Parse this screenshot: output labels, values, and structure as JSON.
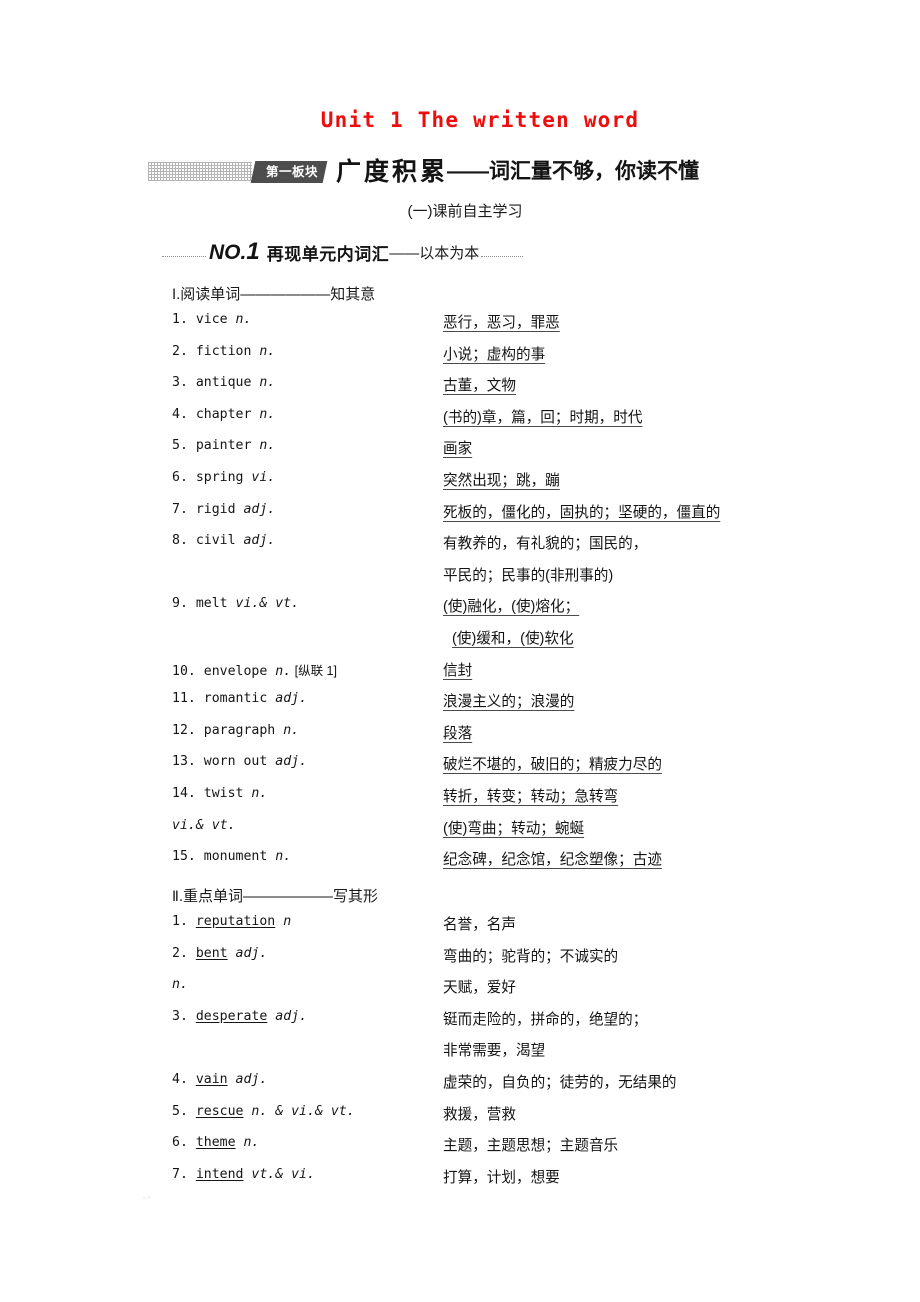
{
  "unit": {
    "title": "Unit 1 The written word",
    "title_color": "#ee0d0d"
  },
  "banner": {
    "tag": "第一板块",
    "main": "广度积累",
    "sub": "——词汇量不够，你读不懂",
    "tag_bg": "#4d4d4d"
  },
  "sub_heading": "(一)课前自主学习",
  "no_heading": {
    "label_prefix": "NO.",
    "label_digit": "1",
    "main": "再现单元内词汇",
    "tail": "——以本为本"
  },
  "sections": [
    {
      "heading_num": "Ⅰ",
      "heading_text": ".阅读单词——————知其意",
      "definitions_underlined": true,
      "rows": [
        {
          "num": "1.",
          "word": "vice",
          "pos": "n.",
          "def": "恶行，恶习，罪恶",
          "underline": true
        },
        {
          "num": "2.",
          "word": "fiction",
          "pos": "n.",
          "def": "小说；虚构的事",
          "underline": true
        },
        {
          "num": "3.",
          "word": "antique",
          "pos": "n.",
          "def": "古董，文物",
          "underline": true
        },
        {
          "num": "4.",
          "word": "chapter",
          "pos": "n.",
          "def": "(书的)章，篇，回；时期，时代",
          "underline": true
        },
        {
          "num": "5.",
          "word": "painter",
          "pos": "n.",
          "def": "画家",
          "underline": true
        },
        {
          "num": "6.",
          "word": "spring",
          "pos": "vi.",
          "def": "突然出现；跳，蹦",
          "underline": true
        },
        {
          "num": "7.",
          "word": "rigid",
          "pos": "adj.",
          "def": "死板的，僵化的，固执的；坚硬的，僵直的",
          "underline": true
        },
        {
          "num": "8.",
          "word": "civil",
          "pos": "adj.",
          "def": "有教养的，有礼貌的；国民的，",
          "underline": false
        },
        {
          "num": "",
          "word": "",
          "pos": "",
          "def": "平民的；民事的(非刑事的)",
          "underline": false
        },
        {
          "num": "9.",
          "word": "melt",
          "pos": "vi.& vt.",
          "def": "(使)融化，(使)熔化；",
          "underline": true
        },
        {
          "num": "",
          "word": "",
          "pos": "",
          "def": "(使)缓和，(使)软化",
          "underline": true,
          "shift": true
        },
        {
          "num": "10.",
          "word": "envelope",
          "pos": "n.",
          "bracket": "[纵联 1]",
          "def": "信封",
          "underline": true
        },
        {
          "num": "11.",
          "word": "romantic",
          "pos": "adj.",
          "def": "浪漫主义的；浪漫的",
          "underline": true
        },
        {
          "num": "12.",
          "word": "paragraph",
          "pos": "n.",
          "def": "段落",
          "underline": true
        },
        {
          "num": "13.",
          "word": "worn out",
          "pos": "adj.",
          "def": "破烂不堪的，破旧的；精疲力尽的",
          "underline": true
        },
        {
          "num": "14.",
          "word": "twist",
          "pos": "n.",
          "def": "转折，转变；转动；急转弯",
          "underline": true
        },
        {
          "num": "",
          "word": "",
          "pos": "vi.& vt.",
          "def": "(使)弯曲；转动；蜿蜒",
          "underline": true
        },
        {
          "num": "15.",
          "word": "monument",
          "pos": "n.",
          "def": "纪念碑，纪念馆，纪念塑像；古迹",
          "underline": true
        }
      ]
    },
    {
      "heading_num": "Ⅱ",
      "heading_text": ".重点单词——————写其形",
      "definitions_underlined": false,
      "rows": [
        {
          "num": "1.",
          "word": "reputation",
          "word_underlined": true,
          "pos": "n",
          "def": "名誉，名声",
          "underline": false
        },
        {
          "num": "2.",
          "word": "bent",
          "word_underlined": true,
          "pos": "adj.",
          "def": "弯曲的；驼背的；不诚实的",
          "underline": false
        },
        {
          "num": "",
          "word": "",
          "pos": "n.",
          "def": "天赋，爱好",
          "underline": false
        },
        {
          "num": "3.",
          "word": "desperate",
          "word_underlined": true,
          "pos": "adj.",
          "def": "铤而走险的，拼命的，绝望的；",
          "underline": false
        },
        {
          "num": "",
          "word": "",
          "pos": "",
          "def": "非常需要，渴望",
          "underline": false
        },
        {
          "num": "4.",
          "word": "vain",
          "word_underlined": true,
          "pos": "adj.",
          "def": "虚荣的，自负的；徒劳的，无结果的",
          "underline": false
        },
        {
          "num": "5.",
          "word": "rescue",
          "word_underlined": true,
          "pos": "n. & vi.& vt.",
          "def": "救援，营救",
          "underline": false
        },
        {
          "num": "6.",
          "word": "theme",
          "word_underlined": true,
          "pos": "n.",
          "def": "主题，主题思想；主题音乐",
          "underline": false
        },
        {
          "num": "7.",
          "word": "intend",
          "word_underlined": true,
          "pos": "vt.& vi.",
          "def": "打算，计划，想要",
          "underline": false
        }
      ]
    }
  ]
}
